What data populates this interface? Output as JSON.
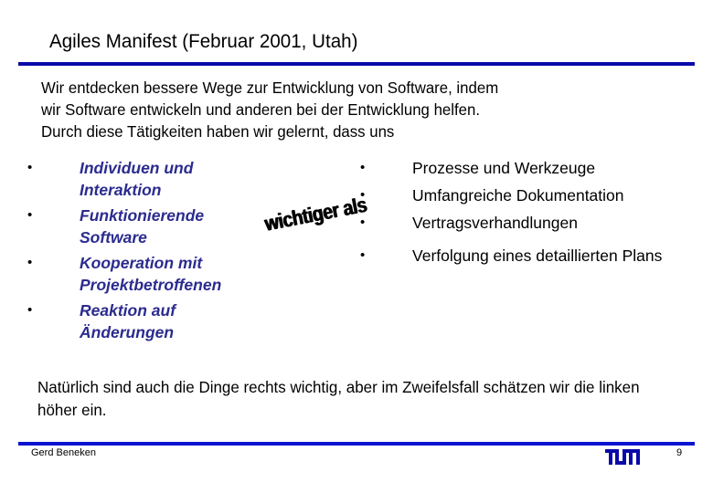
{
  "slide": {
    "title": "Agiles Manifest (Februar 2001, Utah)",
    "intro_lines": [
      "Wir entdecken bessere Wege zur Entwicklung von Software, indem",
      "wir Software entwickeln und anderen bei der Entwicklung helfen.",
      "Durch diese Tätigkeiten haben wir gelernt, dass uns"
    ],
    "left_items": [
      "Individuen und Interaktion",
      "Funktionierende Software",
      "Kooperation mit Projektbetroffenen",
      "Reaktion auf Änderungen"
    ],
    "right_items": [
      "Prozesse und Werkzeuge",
      "Umfangreiche Dokumentation",
      "Vertragsverhandlungen",
      "Verfolgung eines detaillierten Plans"
    ],
    "bullet_glyph": "•",
    "wordart": "wichtiger als",
    "conclusion": "Natürlich sind auch die Dinge rechts wichtig, aber im Zweifelsfall schätzen wir die linken höher ein.",
    "accent_color": "#0a0aa8",
    "left_item_color": "#2b2b8f"
  },
  "footer": {
    "author": "Gerd Beneken",
    "page_number": "9",
    "logo_icon": "tum-logo-icon"
  }
}
